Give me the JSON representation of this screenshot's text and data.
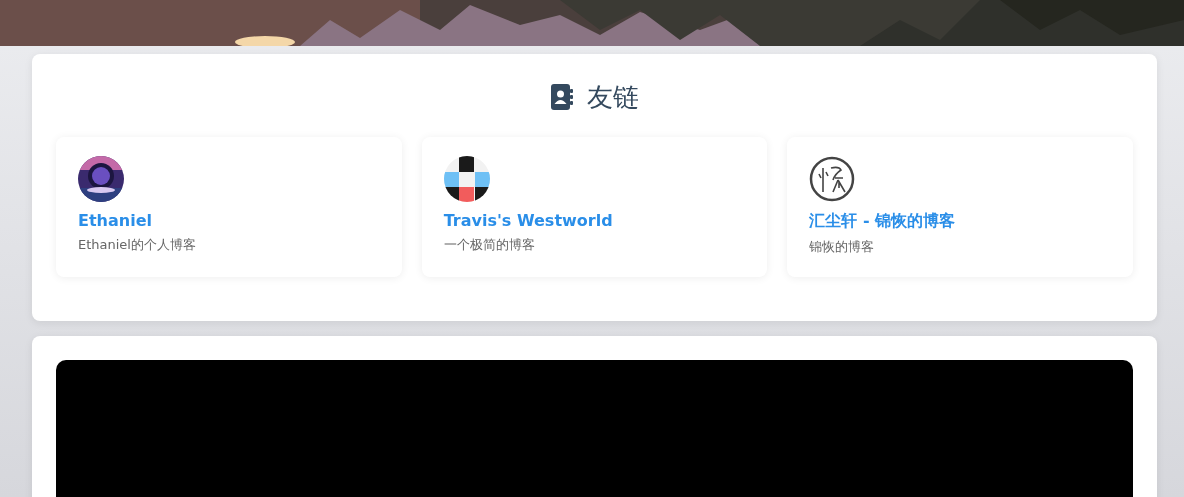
{
  "friends": {
    "title": "友链",
    "links": [
      {
        "name": "Ethaniel",
        "description": "Ethaniel的个人博客"
      },
      {
        "avatar": {
          "kind": "blocks"
        },
        "name": "Travis's Westworld",
        "description": "一个极简的博客"
      },
      {
        "avatar": {
          "kind": "seal"
        },
        "name": "汇尘轩 - 锦恢的博客",
        "description": "锦恢的博客"
      }
    ]
  },
  "media": {
    "kind": "video"
  }
}
